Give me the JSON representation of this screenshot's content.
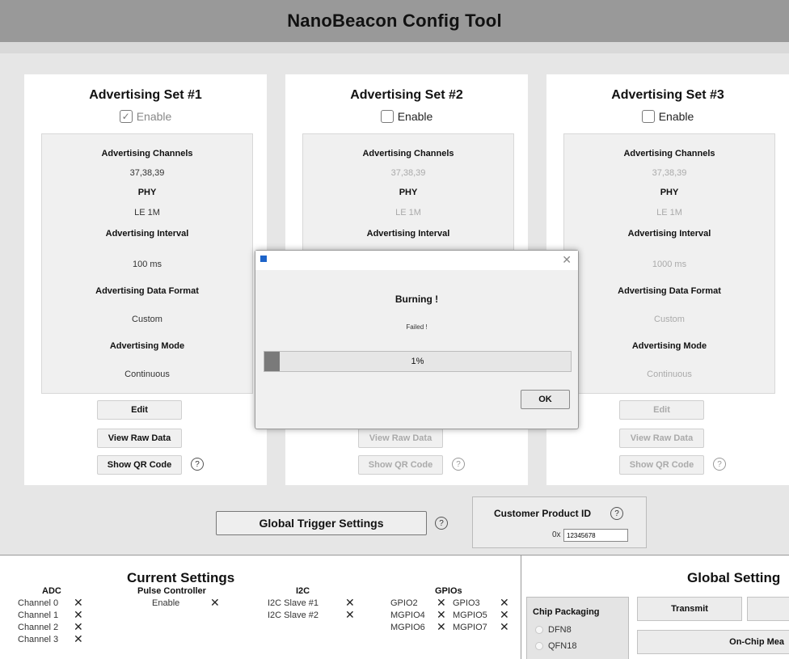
{
  "app": {
    "title": "NanoBeacon Config Tool"
  },
  "sets": [
    {
      "title": "Advertising Set #1",
      "enable_label": "Enable",
      "enabled": true,
      "channels_label": "Advertising Channels",
      "channels": "37,38,39",
      "phy_label": "PHY",
      "phy": "LE 1M",
      "interval_label": "Advertising Interval",
      "interval": "100 ms",
      "format_label": "Advertising Data Format",
      "format": "Custom",
      "mode_label": "Advertising Mode",
      "mode": "Continuous",
      "edit_label": "Edit",
      "raw_label": "View Raw Data",
      "qr_label": "Show QR Code"
    },
    {
      "title": "Advertising Set #2",
      "enable_label": "Enable",
      "enabled": false,
      "channels_label": "Advertising Channels",
      "channels": "37,38,39",
      "phy_label": "PHY",
      "phy": "LE 1M",
      "interval_label": "Advertising Interval",
      "raw_label": "View Raw Data",
      "qr_label": "Show QR Code"
    },
    {
      "title": "Advertising Set #3",
      "enable_label": "Enable",
      "enabled": false,
      "channels_label": "Advertising Channels",
      "channels": "37,38,39",
      "phy_label": "PHY",
      "phy": "LE 1M",
      "interval_label": "Advertising Interval",
      "interval": "1000 ms",
      "format_label": "Advertising Data Format",
      "format": "Custom",
      "mode_label": "Advertising Mode",
      "mode": "Continuous",
      "edit_label": "Edit",
      "raw_label": "View Raw Data",
      "qr_label": "Show QR Code"
    }
  ],
  "global_trigger": {
    "label": "Global Trigger Settings"
  },
  "customer_product_id": {
    "label": "Customer Product ID",
    "prefix": "0x",
    "value": "12345678"
  },
  "current_settings": {
    "title": "Current Settings",
    "adc": {
      "title": "ADC",
      "items": [
        "Channel 0",
        "Channel 1",
        "Channel 2",
        "Channel 3"
      ]
    },
    "pulse": {
      "title": "Pulse Controller",
      "items": [
        "Enable"
      ]
    },
    "i2c": {
      "title": "I2C",
      "items": [
        "I2C Slave #1",
        "I2C Slave #2"
      ]
    },
    "gpios": {
      "title": "GPIOs",
      "items": [
        "GPIO2",
        "GPIO3",
        "MGPIO4",
        "MGPIO5",
        "MGPIO6",
        "MGPIO7"
      ]
    }
  },
  "global_settings": {
    "title": "Global Setting",
    "chip_packaging": {
      "label": "Chip Packaging",
      "options": [
        "DFN8",
        "QFN18"
      ]
    },
    "transmit_label": "Transmit",
    "onchip_label": "On-Chip Mea"
  },
  "dialog": {
    "title": "Burning !",
    "message": "Failed !",
    "progress_text": "1%",
    "progress_value": 0.05,
    "ok_label": "OK"
  },
  "colors": {
    "titlebar": "#999999",
    "background": "#e6e6e6",
    "progress_fill": "#7a7a7a"
  }
}
